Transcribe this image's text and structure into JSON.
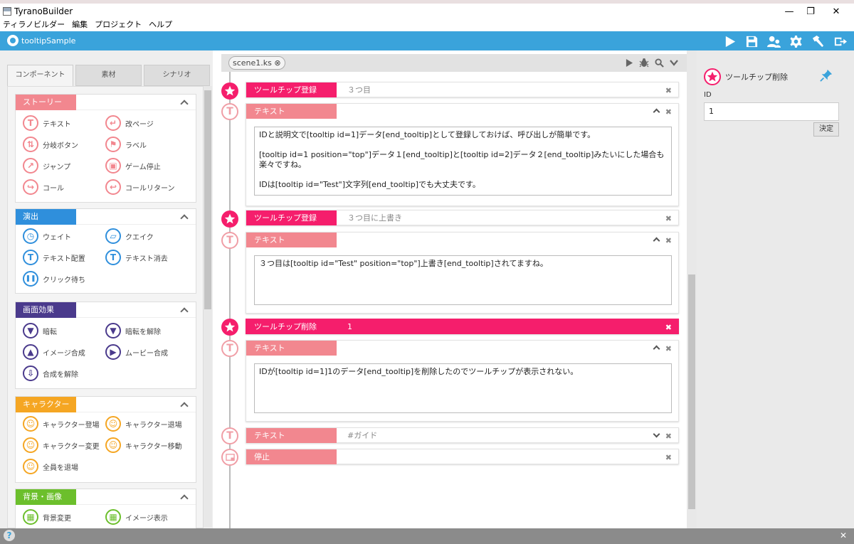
{
  "window": {
    "title": "TyranoBuilder",
    "minimize": "—",
    "restore": "❐",
    "close": "✕"
  },
  "menu": [
    "ティラノビルダー",
    "編集",
    "プロジェクト",
    "ヘルプ"
  ],
  "header": {
    "project_name": "tooltipSample"
  },
  "left": {
    "tabs": [
      "コンポーネント",
      "素材",
      "シナリオ"
    ],
    "active_tab": "コンポーネント",
    "categories": [
      {
        "label": "ストーリー",
        "color": "#f2878f",
        "items": [
          {
            "icon": "text-icon",
            "glyph": "T",
            "label": "テキスト"
          },
          {
            "icon": "page-break-icon",
            "glyph": "↵",
            "label": "改ページ"
          },
          {
            "icon": "branch-button-icon",
            "glyph": "⇅",
            "label": "分岐ボタン"
          },
          {
            "icon": "label-flag-icon",
            "glyph": "⚑",
            "label": "ラベル"
          },
          {
            "icon": "jump-icon",
            "glyph": "↗",
            "label": "ジャンプ"
          },
          {
            "icon": "game-stop-icon",
            "glyph": "▣",
            "label": "ゲーム停止"
          },
          {
            "icon": "call-icon",
            "glyph": "↪",
            "label": "コール"
          },
          {
            "icon": "call-return-icon",
            "glyph": "↩",
            "label": "コールリターン"
          }
        ]
      },
      {
        "label": "演出",
        "color": "#2f8fdc",
        "items": [
          {
            "icon": "wait-icon",
            "glyph": "◷",
            "label": "ウェイト"
          },
          {
            "icon": "shake-icon",
            "glyph": "▱",
            "label": "クエイク"
          },
          {
            "icon": "text-layout-icon",
            "glyph": "T",
            "label": "テキスト配置"
          },
          {
            "icon": "text-clear-icon",
            "glyph": "T",
            "label": "テキスト消去"
          },
          {
            "icon": "click-wait-icon",
            "glyph": "❚❚",
            "label": "クリック待ち"
          }
        ]
      },
      {
        "label": "画面効果",
        "color": "#4a3a8c",
        "items": [
          {
            "icon": "fade-out-icon",
            "glyph": "▼",
            "label": "暗転"
          },
          {
            "icon": "fade-in-icon",
            "glyph": "▼",
            "label": "暗転を解除"
          },
          {
            "icon": "image-compose-icon",
            "glyph": "▲",
            "label": "イメージ合成"
          },
          {
            "icon": "movie-compose-icon",
            "glyph": "▶",
            "label": "ムービー合成"
          },
          {
            "icon": "compose-release-icon",
            "glyph": "⇩",
            "label": "合成を解除"
          }
        ]
      },
      {
        "label": "キャラクター",
        "color": "#f5a623",
        "items": [
          {
            "icon": "character-enter-icon",
            "glyph": "☺",
            "label": "キャラクター登場"
          },
          {
            "icon": "character-exit-icon",
            "glyph": "☺",
            "label": "キャラクター退場"
          },
          {
            "icon": "character-change-icon",
            "glyph": "☺",
            "label": "キャラクター変更"
          },
          {
            "icon": "character-move-icon",
            "glyph": "☺",
            "label": "キャラクター移動"
          },
          {
            "icon": "all-exit-icon",
            "glyph": "☺",
            "label": "全員を退場"
          }
        ]
      },
      {
        "label": "背景・画像",
        "color": "#6cbf2c",
        "items": [
          {
            "icon": "background-change-icon",
            "glyph": "▦",
            "label": "背景変更"
          },
          {
            "icon": "image-show-icon",
            "glyph": "▦",
            "label": "イメージ表示"
          }
        ]
      }
    ]
  },
  "scene": {
    "tab_label": "scene1.ks",
    "tab_close": "⊗",
    "blocks": [
      {
        "kind": "tooltip",
        "label": "ツールチップ登録",
        "value": "３つ目"
      },
      {
        "kind": "text",
        "label": "テキスト",
        "content": "IDと説明文で[tooltip id=1]データ[end_tooltip]として登録しておけば、呼び出しが簡単です。\n\n[tooltip id=1 position=\"top\"]データ１[end_tooltip]と[tooltip id=2]データ２[end_tooltip]みたいにした場合も楽々ですね。\n\nIDは[tooltip id=\"Test\"]文字列[end_tooltip]でも大丈夫です。"
      },
      {
        "kind": "tooltip",
        "label": "ツールチップ登録",
        "value": "３つ目に上書き"
      },
      {
        "kind": "text",
        "label": "テキスト",
        "content": "３つ目は[tooltip id=\"Test\" position=\"top\"]上書き[end_tooltip]されてますね。"
      },
      {
        "kind": "tooltip-delete",
        "label": "ツールチップ削除",
        "value": "1"
      },
      {
        "kind": "text",
        "label": "テキスト",
        "content": "IDが[tooltip id=1]1のデータ[end_tooltip]を削除したのでツールチップが表示されない。"
      },
      {
        "kind": "text-collapsed",
        "label": "テキスト",
        "value": "#ガイド"
      },
      {
        "kind": "stop",
        "label": "停止"
      }
    ]
  },
  "right": {
    "title": "ツールチップ削除",
    "field_label": "ID",
    "field_value": "1",
    "submit_label": "決定"
  },
  "status": {
    "help": "?",
    "close": "✕"
  },
  "colors": {
    "header_blue": "#3aa3db",
    "accent_pink": "#f51e6c",
    "text_pink": "#f2878f"
  }
}
